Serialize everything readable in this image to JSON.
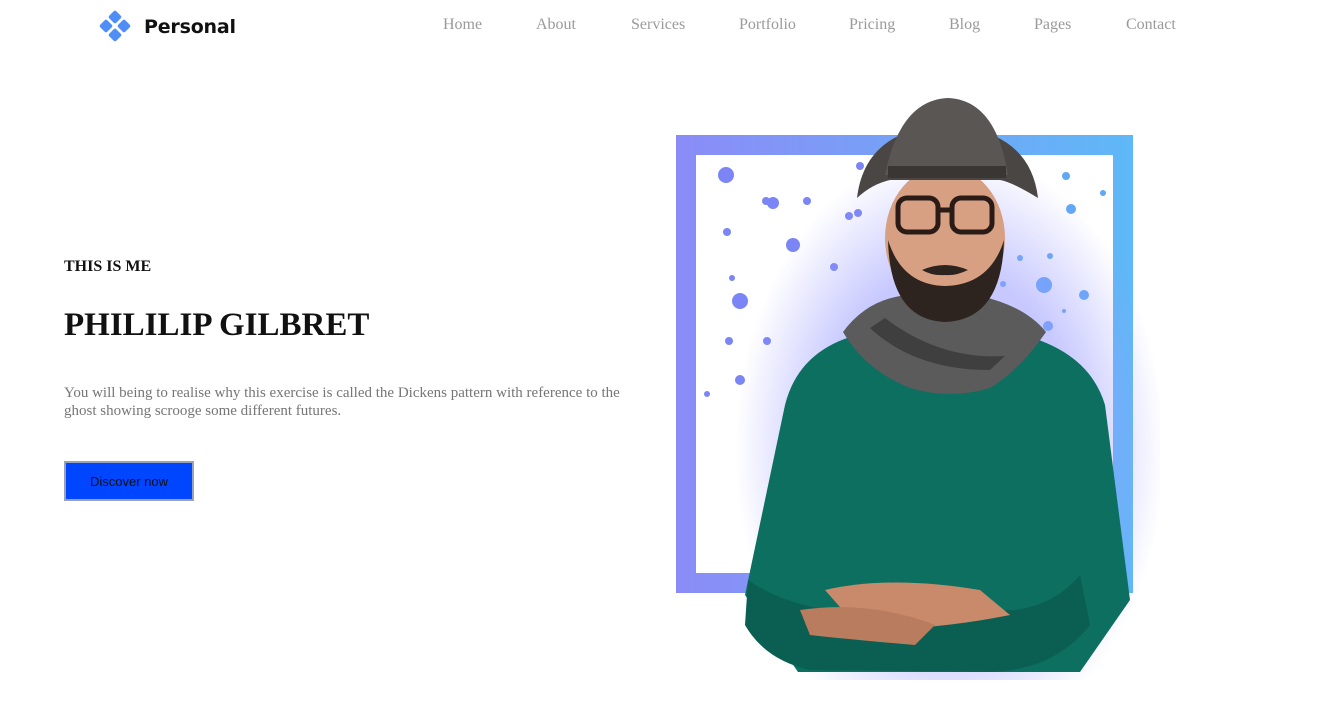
{
  "brand": {
    "name": "Personal",
    "logo_icon": "diamond-cluster-icon",
    "logo_color": "#4f8ef7"
  },
  "nav": {
    "items": [
      "Home",
      "About",
      "Services",
      "Portfolio",
      "Pricing",
      "Blog",
      "Pages",
      "Contact"
    ]
  },
  "hero": {
    "kicker": "THIS IS ME",
    "name": "PHILILIP GILBRET",
    "description": "You will being to realise why this exercise is called the Dickens pattern with reference to the ghost showing scrooge some different futures.",
    "cta_label": "Discover now",
    "cta_color": "#0045ff"
  },
  "portrait": {
    "frame_gradient": [
      "#8b8cf7",
      "#5fb8f7"
    ],
    "image": "portrait-photo"
  }
}
